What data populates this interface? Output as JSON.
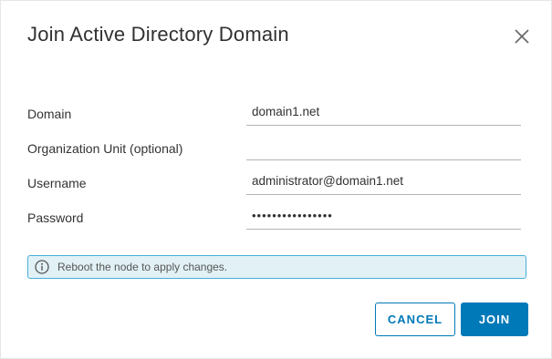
{
  "dialog": {
    "title": "Join Active Directory Domain",
    "close_icon": "close-icon"
  },
  "form": {
    "domain": {
      "label": "Domain",
      "value": "domain1.net"
    },
    "org_unit": {
      "label": "Organization Unit (optional)",
      "value": ""
    },
    "username": {
      "label": "Username",
      "value": "administrator@domain1.net"
    },
    "password": {
      "label": "Password",
      "value": "••••••••••••••••"
    }
  },
  "alert": {
    "icon": "info-icon",
    "message": "Reboot the node to apply changes."
  },
  "buttons": {
    "cancel_label": "CANCEL",
    "join_label": "JOIN"
  },
  "colors": {
    "primary": "#0079b8",
    "alert_background": "#e1f1f6",
    "alert_border": "#49afd9"
  }
}
